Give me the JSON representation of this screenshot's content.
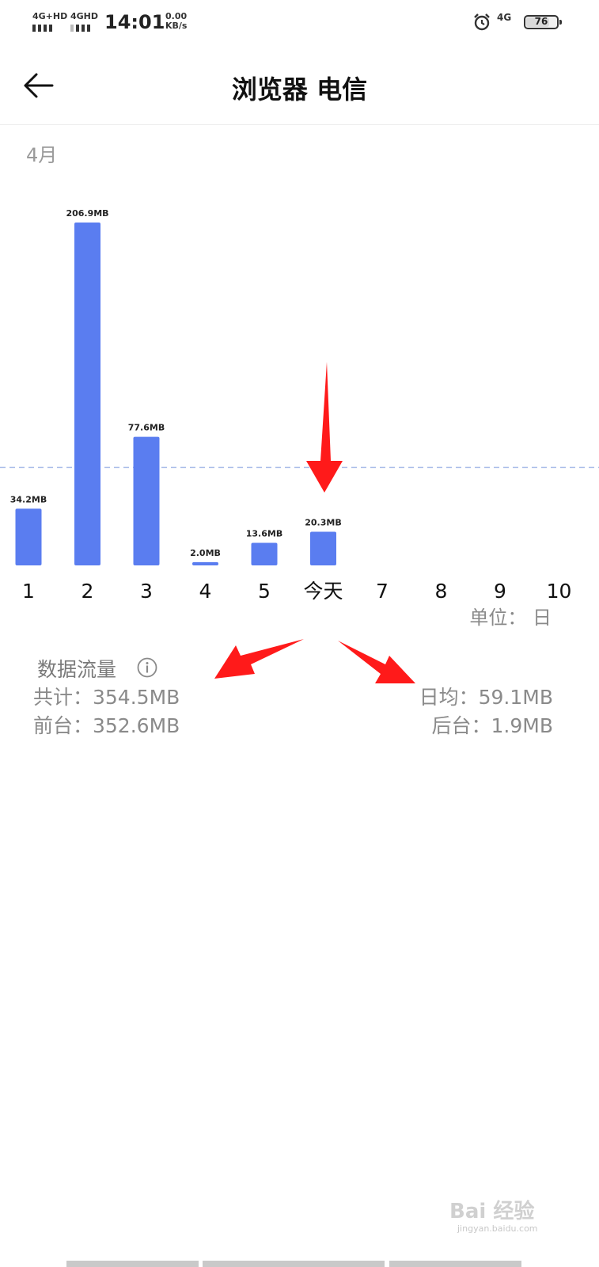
{
  "status_bar": {
    "sim1": "4G+HD",
    "sim2": "4GHD",
    "time": "14:01",
    "speed_value": "0.00",
    "speed_unit": "KB/s",
    "network": "4G",
    "battery": "76",
    "battery_fraction": 0.76
  },
  "header": {
    "back_icon": "arrow-left-icon",
    "title": "浏览器 电信"
  },
  "month_label": "4月",
  "chart_data": {
    "type": "bar",
    "categories": [
      "1",
      "2",
      "3",
      "4",
      "5",
      "今天",
      "7",
      "8",
      "9",
      "10"
    ],
    "values": [
      34.2,
      206.9,
      77.6,
      2.0,
      13.6,
      20.3,
      null,
      null,
      null,
      null
    ],
    "value_labels": [
      "34.2MB",
      "206.9MB",
      "77.6MB",
      "2.0MB",
      "13.6MB",
      "20.3MB",
      "",
      "",
      "",
      ""
    ],
    "average_line": 59.1,
    "unit_label": "单位： 日",
    "bar_color": "#5a7df0",
    "average_line_color": "#a9bce9",
    "ylim": [
      0,
      215
    ]
  },
  "summary": {
    "title": "数据流量",
    "info_icon": "info-circle-icon",
    "total": "共计：354.5MB",
    "foreground": "前台：352.6MB",
    "daily_avg": "日均：59.1MB",
    "background": "后台：1.9MB"
  },
  "watermark": {
    "brand": "Bai 经验",
    "domain": "jingyan.baidu.com"
  },
  "colors": {
    "annotation": "#ff1a1a",
    "secondary_text": "#8a8a8a"
  }
}
